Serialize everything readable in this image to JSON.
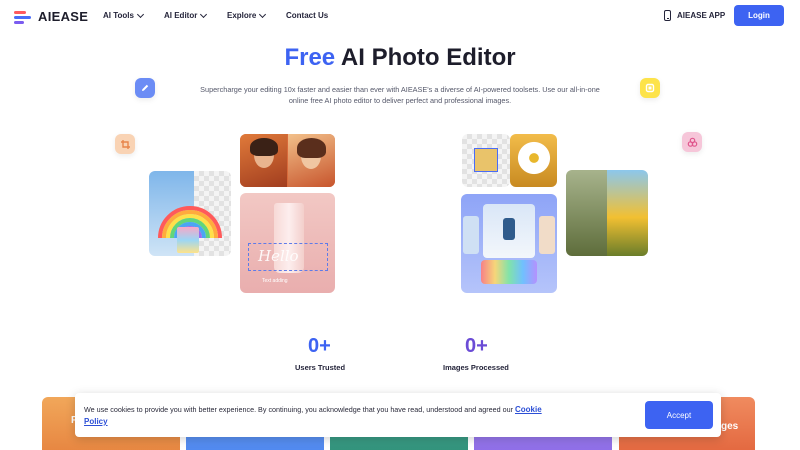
{
  "brand": {
    "name": "AIEASE"
  },
  "nav": {
    "items": [
      {
        "label": "AI Tools",
        "dropdown": true
      },
      {
        "label": "AI Editor",
        "dropdown": true
      },
      {
        "label": "Explore",
        "dropdown": true
      },
      {
        "label": "Contact Us",
        "dropdown": false
      }
    ],
    "app_label": "AIEASE APP",
    "login_label": "Login"
  },
  "hero": {
    "title_highlight": "Free",
    "title_rest": " AI Photo Editor",
    "subtitle": "Supercharge your editing 10x faster and easier than ever with AIEASE's a diverse of AI-powered toolsets. Use our all-in-one online free AI photo editor to deliver perfect and professional images.",
    "sample_text": "Hello",
    "sample_caption": "Text adding"
  },
  "stats": [
    {
      "value": "0+",
      "label": "Users Trusted",
      "color": "#3d63f2"
    },
    {
      "value": "0+",
      "label": "Images Processed",
      "color": "#6b4cd6"
    }
  ],
  "feature_cards": {
    "first_fragment": "P",
    "last_fragment": "ges"
  },
  "cookie": {
    "text": "We use cookies to provide you with better experience. By continuing, you acknowledge that you have read, understood and agreed our ",
    "link_label": "Cookie Policy",
    "accept_label": "Accept"
  },
  "colors": {
    "accent": "#3d63f2",
    "title": "#1d1d2b"
  },
  "icons": [
    "pencil-icon",
    "crop-icon",
    "square-icon",
    "palette-icon",
    "phone-icon",
    "chevron-down-icon"
  ]
}
